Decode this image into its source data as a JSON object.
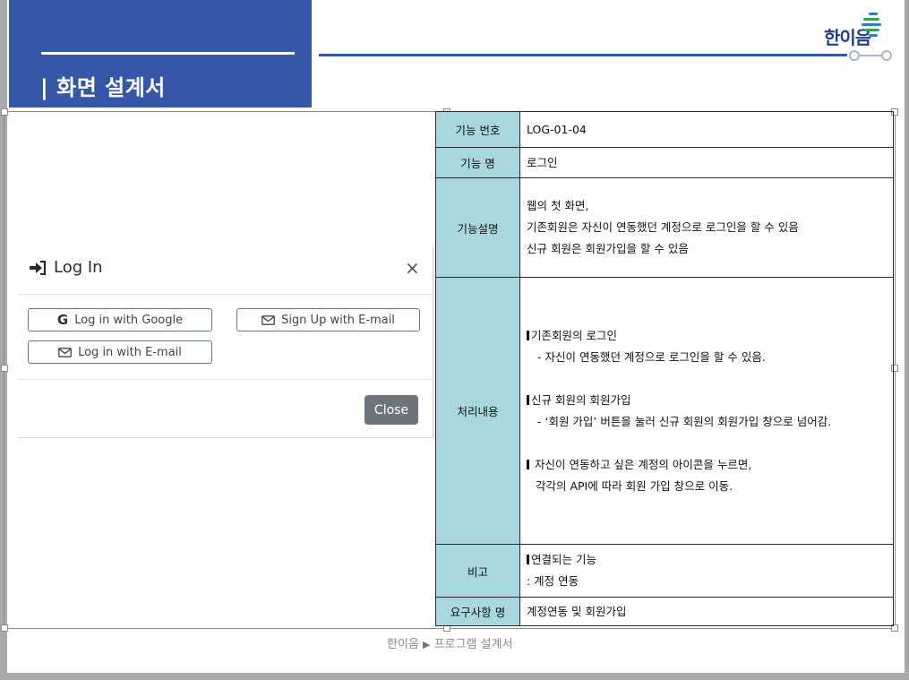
{
  "header": {
    "banner_title": "| 화면 설계서",
    "logo_text": "한이음",
    "brand_color": "#3657a8"
  },
  "modal": {
    "title": "Log In",
    "title_icon": "sign-in-icon",
    "close_symbol": "×",
    "buttons": {
      "google": "Log in with Google",
      "signup_email": "Sign Up with E-mail",
      "login_email": "Log in with E-mail"
    },
    "close_label": "Close"
  },
  "spec": {
    "func_no_label": "기능 번호",
    "func_no": "LOG-01-04",
    "func_name_label": "기능 명",
    "func_name": "로그인",
    "desc_label": "기능설명",
    "desc": [
      "웹의 첫 화면,",
      "기존회원은 자신이 연동했던 계정으로 로그인을 할 수 있음",
      "신규 회원은 회원가입을 할 수 있음"
    ],
    "proc_label": "처리내용",
    "proc": {
      "h1": "기존회원의 로그인",
      "d1": "-  자신이 연동했던 계정으로 로그인을 할 수 있음.",
      "h2": "신규 회원의 회원가입",
      "d2": "-  ‘회원 가입’ 버튼을 눌러 신규 회원의 회원가입 창으로 넘어감.",
      "h3": " 자신이 연동하고 싶은 계정의 아이콘을 누르면,",
      "d3": "각각의 API에 따라 회원 가입 창으로 이동."
    },
    "note_label": "비고",
    "note_head": "연결되는 기능",
    "note_body": ": 계정 연동",
    "req_label": "요구사항 명",
    "req": "계정연동 및 회원가입"
  },
  "footer": {
    "left": "한이음",
    "arrow": "▶",
    "right": "프로그램 설계서"
  }
}
